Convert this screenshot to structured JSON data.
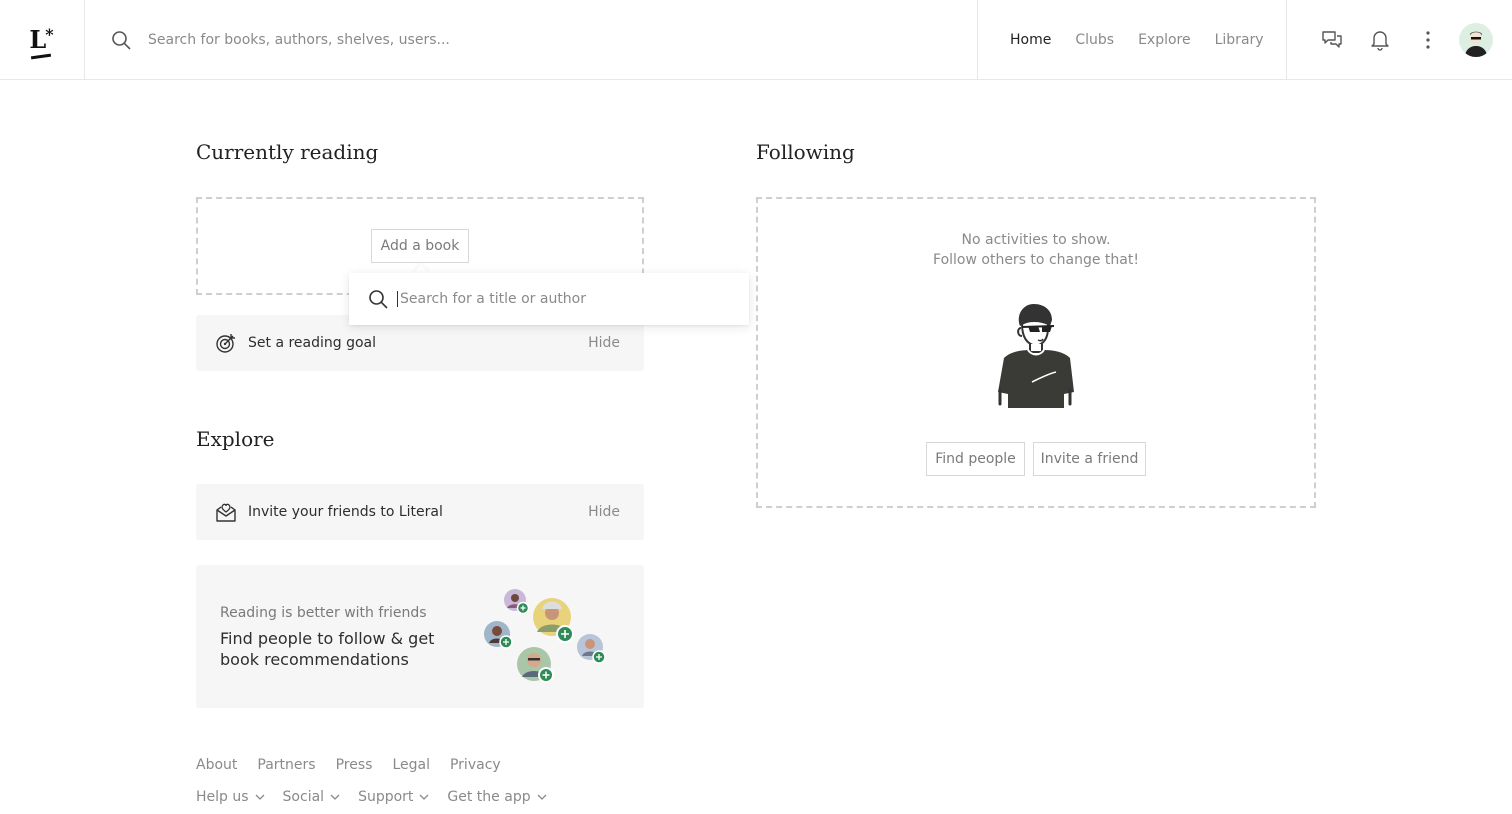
{
  "header": {
    "logo_text": "L",
    "logo_star": "*",
    "search_placeholder": "Search for books, authors, shelves, users...",
    "nav": [
      {
        "label": "Home",
        "active": true
      },
      {
        "label": "Clubs",
        "active": false
      },
      {
        "label": "Explore",
        "active": false
      },
      {
        "label": "Library",
        "active": false
      }
    ],
    "icons": [
      "messages-icon",
      "bell-icon",
      "more-vertical-icon",
      "user-avatar"
    ]
  },
  "currently_reading": {
    "title": "Currently reading",
    "add_book_label": "Add a book",
    "popover_placeholder": "Search for a title or author",
    "goal_card": {
      "label": "Set a reading goal",
      "hide": "Hide"
    }
  },
  "explore": {
    "title": "Explore",
    "invite_card": {
      "label": "Invite your friends to Literal",
      "hide": "Hide"
    },
    "friends_card": {
      "small": "Reading is better with friends",
      "big": "Find people to follow & get book recommendations"
    }
  },
  "following": {
    "title": "Following",
    "empty_line1": "No activities to show.",
    "empty_line2": "Follow others to change that!",
    "find_people": "Find people",
    "invite_friend": "Invite a friend"
  },
  "footer": {
    "links": [
      "About",
      "Partners",
      "Press",
      "Legal",
      "Privacy"
    ],
    "menus": [
      "Help us",
      "Social",
      "Support",
      "Get the app"
    ]
  },
  "colors": {
    "accent_green": "#2e8b57",
    "text_dark": "#222222",
    "text_muted": "#8a8a8a",
    "card_bg": "#f6f6f6"
  }
}
